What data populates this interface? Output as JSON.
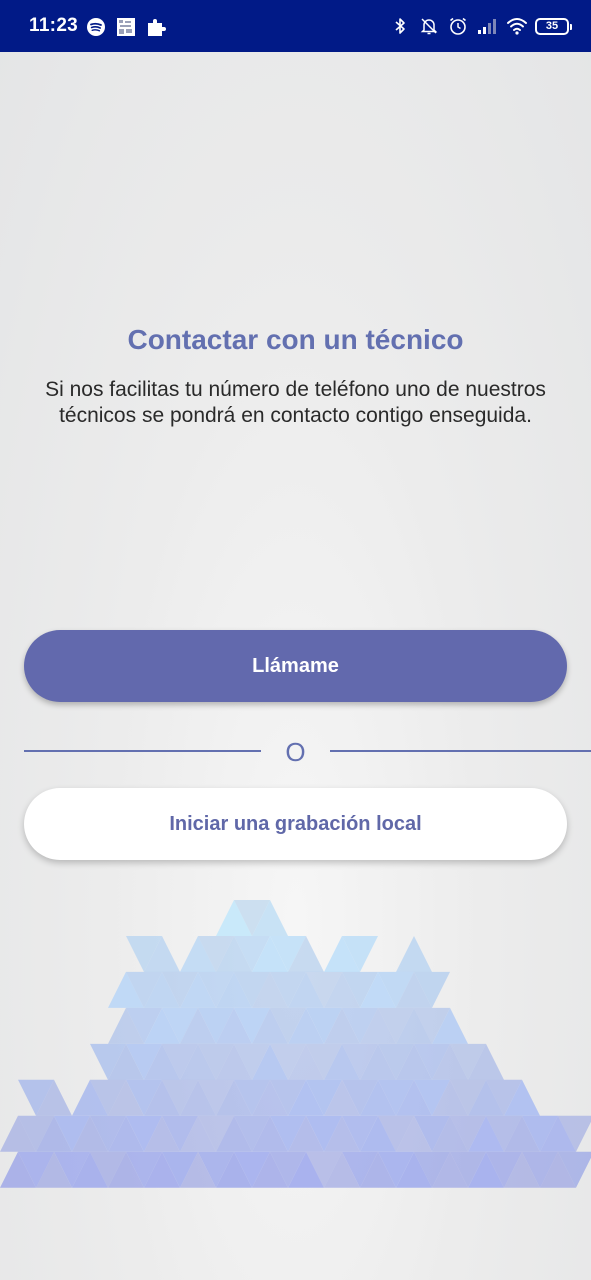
{
  "status_bar": {
    "time": "11:23",
    "left_icons": [
      "spotify-icon",
      "image-icon",
      "puzzle-icon"
    ],
    "right_icons": [
      "bluetooth-icon",
      "bell-off-icon",
      "alarm-icon",
      "signal-icon",
      "wifi-icon"
    ],
    "battery_level": "35"
  },
  "main": {
    "title": "Contactar con un técnico",
    "description": "Si nos facilitas tu número de teléfono uno de nuestros técnicos se pondrá en contacto contigo enseguida.",
    "call_button_label": "Llámame",
    "divider_text": "O",
    "record_button_label": "Iniciar una grabación local"
  },
  "colors": {
    "status_bar": "#011a87",
    "accent": "#6370b0",
    "primary_button": "#6269ad",
    "secondary_button": "#ffffff",
    "pattern_light_blue": "#a6d9f0",
    "pattern_purple": "#8f8fdc"
  }
}
